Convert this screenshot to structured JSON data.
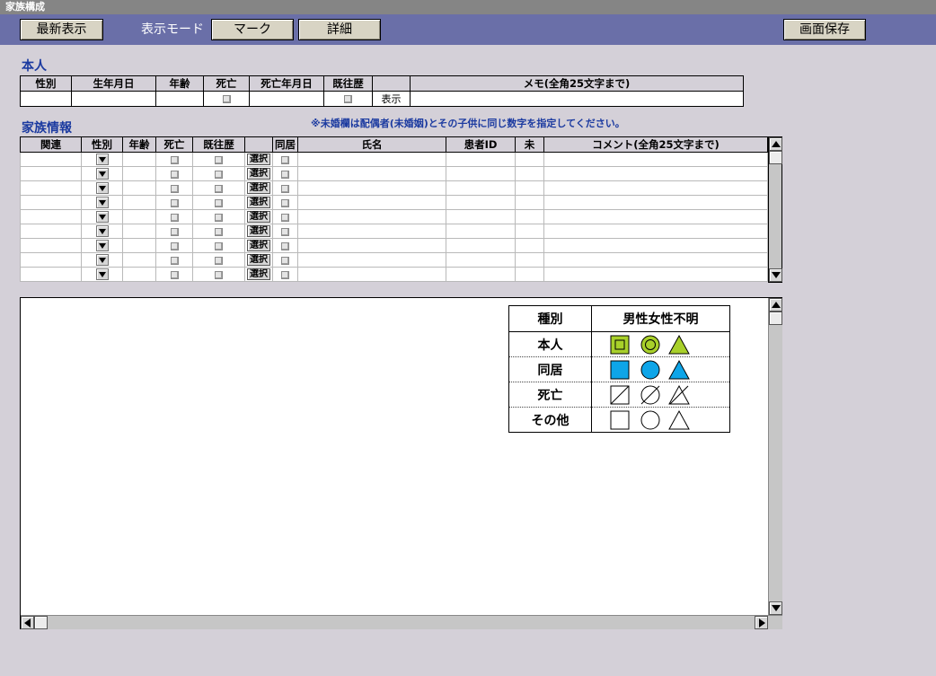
{
  "window": {
    "title": "家族構成"
  },
  "toolbar": {
    "refresh_label": "最新表示",
    "mode_label": "表示モード",
    "mark_label": "マーク",
    "detail_label": "詳細",
    "save_label": "画面保存"
  },
  "self_section": {
    "title": "本人",
    "columns": [
      "性別",
      "生年月日",
      "年齢",
      "死亡",
      "死亡年月日",
      "既往歴",
      "",
      "メモ(全角25文字まで)"
    ],
    "show_label": "表示"
  },
  "family_section": {
    "title": "家族情報",
    "notice": "※未婚欄は配偶者(未婚姻)とその子供に同じ数字を指定してください。",
    "columns": [
      "関連",
      "性別",
      "年齢",
      "死亡",
      "既往歴",
      "",
      "同居",
      "氏名",
      "患者ID",
      "未",
      "コメント(全角25文字まで)"
    ],
    "select_label": "選択",
    "row_count": 9
  },
  "legend": {
    "header_type": "種別",
    "header_symbols": "男性女性不明",
    "rows": [
      "本人",
      "同居",
      "死亡",
      "その他"
    ]
  },
  "colors": {
    "self_fill": "#a8d02a",
    "cohabit_fill": "#0ea5e8",
    "title_blue": "#1b3aa0",
    "toolbar_bg": "#6a6fa8"
  }
}
